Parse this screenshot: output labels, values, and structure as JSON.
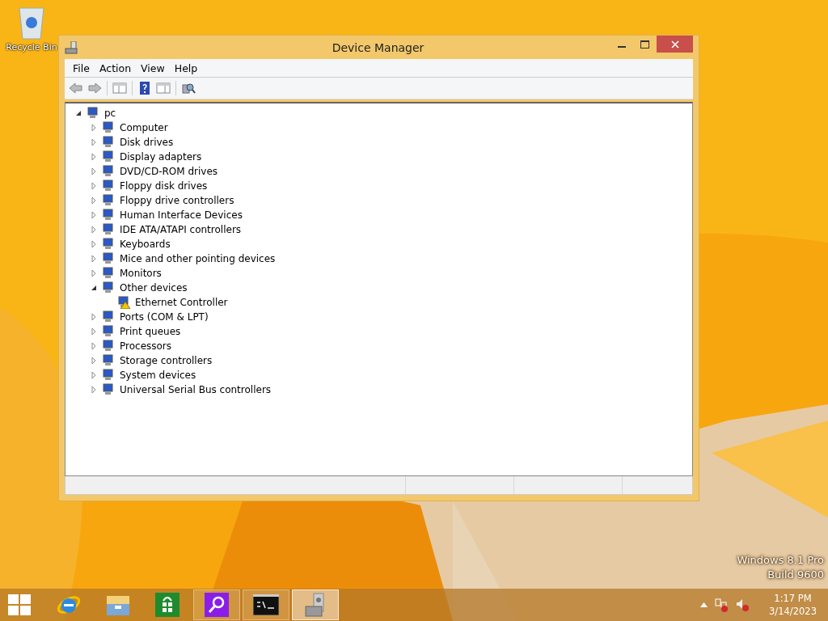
{
  "desktop": {
    "icons": [
      {
        "label": "Recycle Bin"
      }
    ],
    "edition": {
      "line_1": "Windows 8.1 Pro",
      "line_2": "Build 9600"
    }
  },
  "window": {
    "title": "Device Manager",
    "menu": [
      "File",
      "Action",
      "View",
      "Help"
    ],
    "tree": {
      "label": "pc",
      "expanded": true,
      "children": [
        {
          "label": "Computer",
          "expanded": false
        },
        {
          "label": "Disk drives",
          "expanded": false
        },
        {
          "label": "Display adapters",
          "expanded": false
        },
        {
          "label": "DVD/CD-ROM drives",
          "expanded": false
        },
        {
          "label": "Floppy disk drives",
          "expanded": false
        },
        {
          "label": "Floppy drive controllers",
          "expanded": false
        },
        {
          "label": "Human Interface Devices",
          "expanded": false
        },
        {
          "label": "IDE ATA/ATAPI controllers",
          "expanded": false
        },
        {
          "label": "Keyboards",
          "expanded": false
        },
        {
          "label": "Mice and other pointing devices",
          "expanded": false
        },
        {
          "label": "Monitors",
          "expanded": false
        },
        {
          "label": "Other devices",
          "expanded": true,
          "children": [
            {
              "label": "Ethernet Controller",
              "warning": true
            }
          ]
        },
        {
          "label": "Ports (COM & LPT)",
          "expanded": false
        },
        {
          "label": "Print queues",
          "expanded": false
        },
        {
          "label": "Processors",
          "expanded": false
        },
        {
          "label": "Storage controllers",
          "expanded": false
        },
        {
          "label": "System devices",
          "expanded": false
        },
        {
          "label": "Universal Serial Bus controllers",
          "expanded": false
        }
      ]
    }
  },
  "taskbar": {
    "apps": [
      {
        "kind": "ie",
        "running": false,
        "selected": false
      },
      {
        "kind": "explorer",
        "running": false,
        "selected": false
      },
      {
        "kind": "store",
        "running": false,
        "selected": false
      },
      {
        "kind": "search",
        "running": true,
        "selected": false
      },
      {
        "kind": "console",
        "running": true,
        "selected": false
      },
      {
        "kind": "devmgr",
        "running": true,
        "selected": true
      }
    ],
    "clock": {
      "time": "1:17 PM",
      "date": "3/14/2023"
    }
  }
}
